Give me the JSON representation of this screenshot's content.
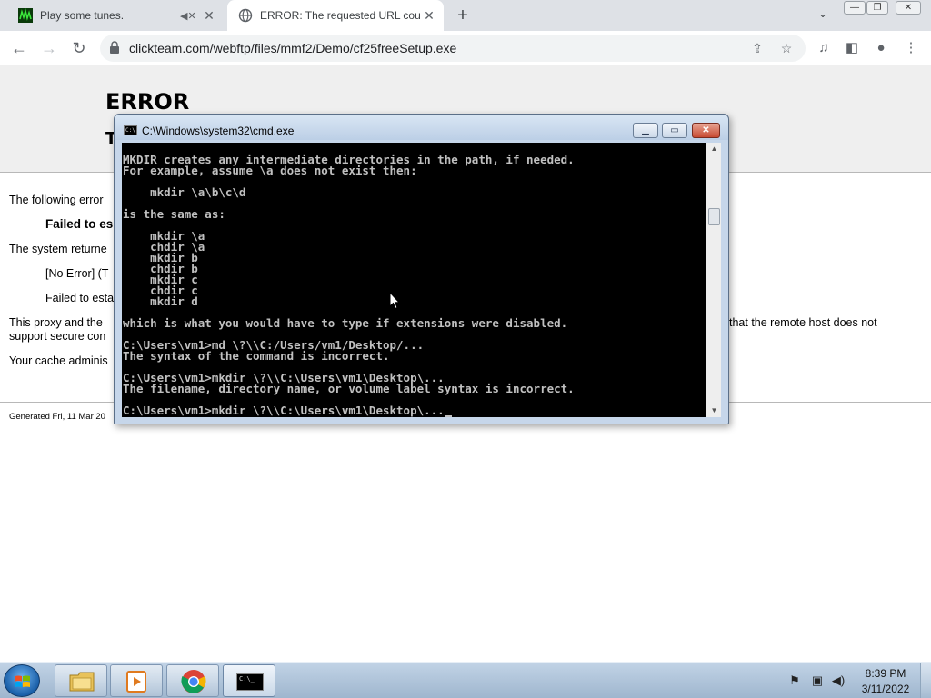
{
  "browser": {
    "tabs": [
      {
        "title": "Play some tunes.",
        "active": false,
        "audio_icon": "speaker-mute-icon"
      },
      {
        "title": "ERROR: The requested URL could",
        "active": true
      }
    ],
    "window_buttons": [
      "minimize",
      "restore",
      "close"
    ],
    "url": "clickteam.com/webftp/files/mmf2/Demo/cf25freeSetup.exe"
  },
  "page": {
    "error_title": "ERROR",
    "subtitle_fragment": "T",
    "line1": "The following error",
    "failed_bold": "Failed to es",
    "line2": "The system returne",
    "no_error": "[No Error] (T",
    "failed2": "Failed to esta",
    "proxy_left": "This proxy and the",
    "proxy_right": "that the remote host does not",
    "proxy_line2": "support secure con",
    "cache": "Your cache adminis",
    "generated": "Generated Fri, 11 Mar 20"
  },
  "cmd": {
    "title": "C:\\Windows\\system32\\cmd.exe",
    "lines": [
      "MKDIR creates any intermediate directories in the path, if needed.",
      "For example, assume \\a does not exist then:",
      "",
      "    mkdir \\a\\b\\c\\d",
      "",
      "is the same as:",
      "",
      "    mkdir \\a",
      "    chdir \\a",
      "    mkdir b",
      "    chdir b",
      "    mkdir c",
      "    chdir c",
      "    mkdir d",
      "",
      "which is what you would have to type if extensions were disabled.",
      "",
      "C:\\Users\\vm1>md \\?\\\\C:/Users/vm1/Desktop/...",
      "The syntax of the command is incorrect.",
      "",
      "C:\\Users\\vm1>mkdir \\?\\\\C:\\Users\\vm1\\Desktop\\...",
      "The filename, directory name, or volume label syntax is incorrect.",
      "",
      "C:\\Users\\vm1>mkdir \\?\\\\C:\\Users\\vm1\\Desktop\\..."
    ]
  },
  "taskbar": {
    "apps": [
      "explorer",
      "media-player",
      "chrome",
      "cmd"
    ],
    "time": "8:39 PM",
    "date": "3/11/2022"
  },
  "colors": {
    "console_bg": "#000000",
    "console_text": "#c0c0c0",
    "error_band": "#efefef"
  }
}
